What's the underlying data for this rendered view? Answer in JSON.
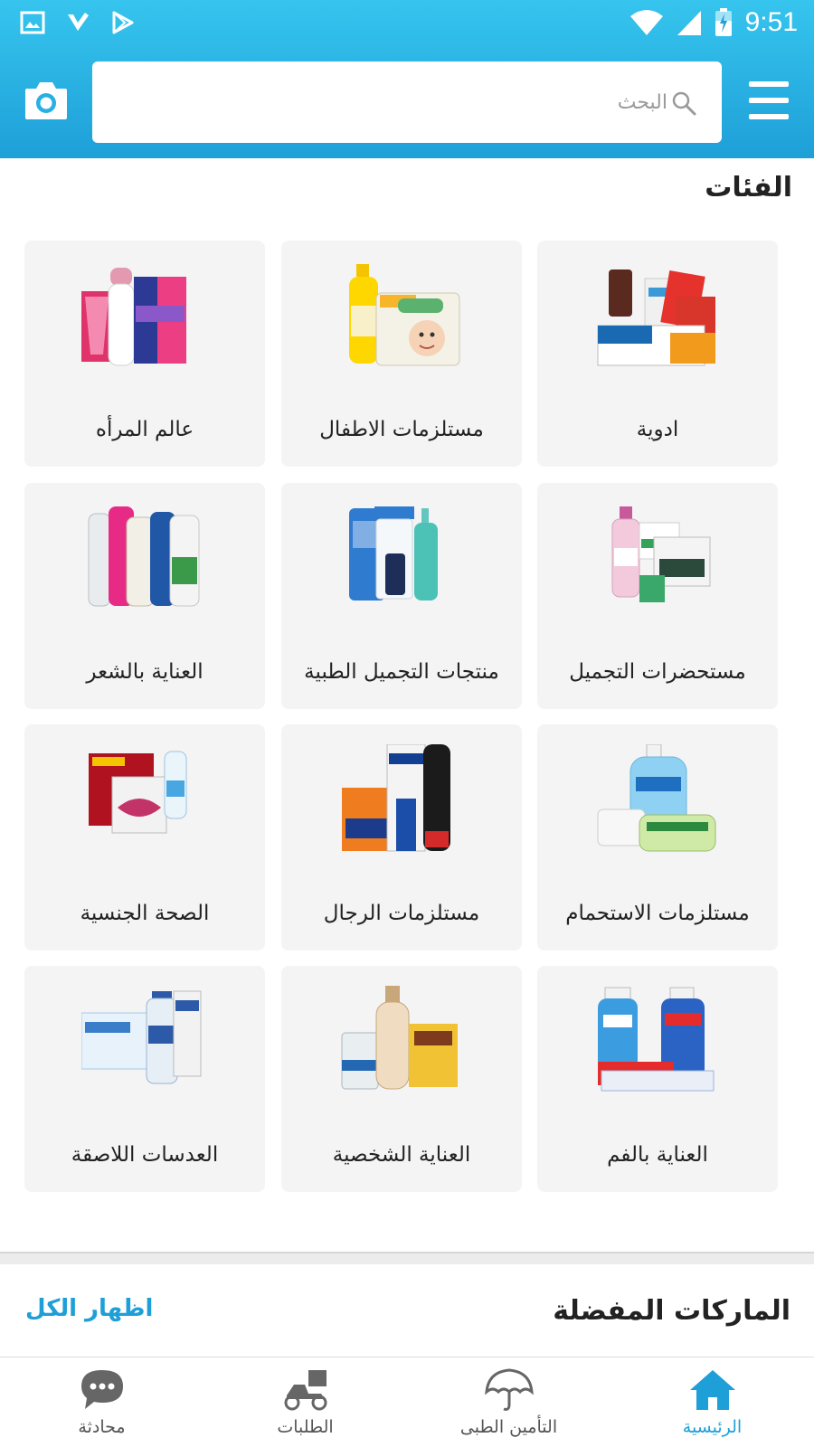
{
  "status_bar": {
    "time": "9:51",
    "icons_left": [
      "image-icon",
      "checkmark-badge-icon",
      "play-store-icon"
    ],
    "icons_right": [
      "wifi-icon",
      "signal-icon",
      "battery-charging-icon"
    ]
  },
  "header": {
    "search_placeholder": "البحث",
    "camera_icon": "camera-icon",
    "menu_icon": "hamburger-menu-icon"
  },
  "categories": {
    "title": "الفئات",
    "items": [
      {
        "label": "ادوية",
        "icon": "medicine-products"
      },
      {
        "label": "مستلزمات الاطفال",
        "icon": "baby-products"
      },
      {
        "label": "عالم المرأه",
        "icon": "women-products"
      },
      {
        "label": "مستحضرات التجميل",
        "icon": "cosmetics-products"
      },
      {
        "label": "منتجات التجميل الطبية",
        "icon": "derma-products"
      },
      {
        "label": "العناية بالشعر",
        "icon": "hair-care-products"
      },
      {
        "label": "مستلزمات الاستحمام",
        "icon": "bath-products"
      },
      {
        "label": "مستلزمات الرجال",
        "icon": "men-products"
      },
      {
        "label": "الصحة الجنسية",
        "icon": "sexual-health-products"
      },
      {
        "label": "العناية بالفم",
        "icon": "oral-care-products"
      },
      {
        "label": "العناية الشخصية",
        "icon": "personal-care-products"
      },
      {
        "label": "العدسات اللاصقة",
        "icon": "contact-lens-products"
      }
    ]
  },
  "brands": {
    "title": "الماركات المفضلة",
    "show_all": "اظهار الكل"
  },
  "bottom_nav": {
    "items": [
      {
        "label": "الرئيسية",
        "icon": "home-icon",
        "active": true
      },
      {
        "label": "التأمين الطبى",
        "icon": "umbrella-icon",
        "active": false
      },
      {
        "label": "الطلبات",
        "icon": "delivery-scooter-icon",
        "active": false
      },
      {
        "label": "محادثة",
        "icon": "chat-bubble-icon",
        "active": false
      }
    ]
  },
  "colors": {
    "accent": "#1e9fd8",
    "header_top": "#36c5ee",
    "card_bg": "#f4f4f4"
  }
}
